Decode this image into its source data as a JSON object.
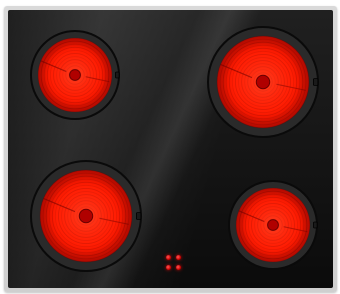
{
  "cooktop": {
    "style": "black glass ceramic hob with four radiant zones",
    "colors": {
      "frame": "#d6d6d6",
      "glass": "#141414",
      "heat": "#ff1a00",
      "heat_dark": "#9b0000",
      "rim": "#2a2a2a"
    },
    "burners": [
      {
        "name": "rear-left"
      },
      {
        "name": "rear-right"
      },
      {
        "name": "front-left"
      },
      {
        "name": "front-right"
      }
    ],
    "controls": {
      "indicator_count": 4
    }
  }
}
